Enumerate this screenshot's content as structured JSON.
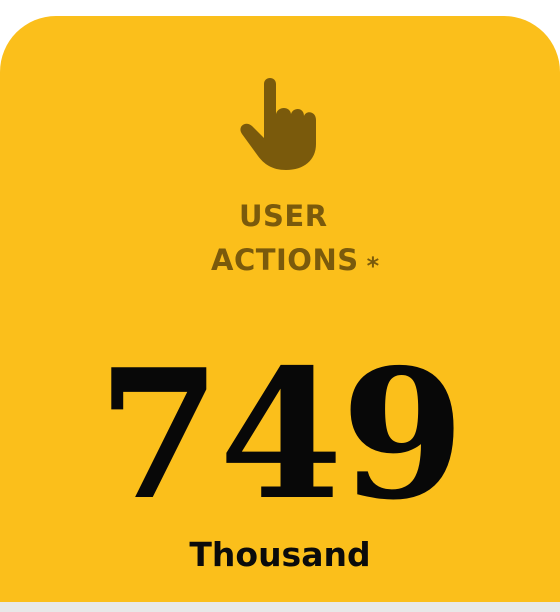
{
  "colors": {
    "card_background": "#fbbf1b",
    "icon": "#7a5a0c",
    "label": "#7a5a0c",
    "value": "#080808",
    "unit": "#0b0b0b"
  },
  "metric": {
    "icon": "pointing-hand-icon",
    "label_line1": "USER",
    "label_line2": "ACTIONS",
    "asterisk": "*",
    "value": "749",
    "unit": "Thousand"
  }
}
